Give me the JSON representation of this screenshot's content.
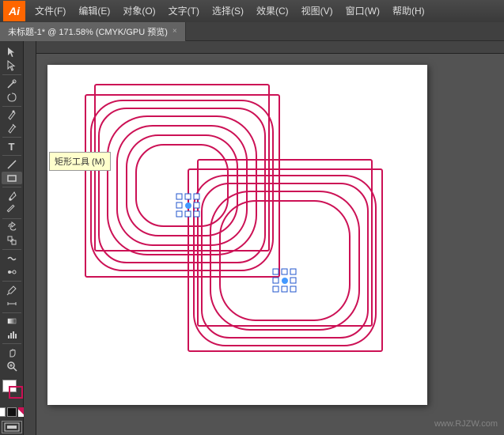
{
  "app": {
    "logo": "Ai",
    "logo_bg": "#ff6600"
  },
  "menubar": {
    "items": [
      {
        "label": "文件(F)"
      },
      {
        "label": "编辑(E)"
      },
      {
        "label": "对象(O)"
      },
      {
        "label": "文字(T)"
      },
      {
        "label": "选择(S)"
      },
      {
        "label": "效果(C)"
      },
      {
        "label": "视图(V)"
      },
      {
        "label": "窗口(W)"
      },
      {
        "label": "帮助(H)"
      }
    ]
  },
  "tab": {
    "title": "未标题-1* @ 171.58% (CMYK/GPU 预览)"
  },
  "tooltip": {
    "text": "矩形工具 (M)"
  },
  "watermark": {
    "text": "www.RJZW.com"
  },
  "toolbar": {
    "tools": [
      {
        "name": "select-tool",
        "icon": "▸"
      },
      {
        "name": "direct-select-tool",
        "icon": "▹"
      },
      {
        "name": "magic-wand-tool",
        "icon": "✦"
      },
      {
        "name": "lasso-tool",
        "icon": "⟳"
      },
      {
        "name": "pen-tool",
        "icon": "✒"
      },
      {
        "name": "type-tool",
        "icon": "T"
      },
      {
        "name": "line-tool",
        "icon": "╲"
      },
      {
        "name": "rect-tool",
        "icon": "▭"
      },
      {
        "name": "paintbrush-tool",
        "icon": "✏"
      },
      {
        "name": "pencil-tool",
        "icon": "✐"
      },
      {
        "name": "rotate-tool",
        "icon": "↻"
      },
      {
        "name": "scale-tool",
        "icon": "⤡"
      },
      {
        "name": "warp-tool",
        "icon": "≋"
      },
      {
        "name": "blend-tool",
        "icon": "⊞"
      },
      {
        "name": "eyedropper-tool",
        "icon": "⊕"
      },
      {
        "name": "mesh-tool",
        "icon": "⊞"
      },
      {
        "name": "gradient-tool",
        "icon": "◫"
      },
      {
        "name": "chart-tool",
        "icon": "▦"
      },
      {
        "name": "slice-tool",
        "icon": "✂"
      },
      {
        "name": "hand-tool",
        "icon": "✋"
      },
      {
        "name": "zoom-tool",
        "icon": "⊕"
      }
    ]
  },
  "colors": {
    "primary": "#cc1155",
    "white": "#ffffff",
    "none": "transparent"
  }
}
